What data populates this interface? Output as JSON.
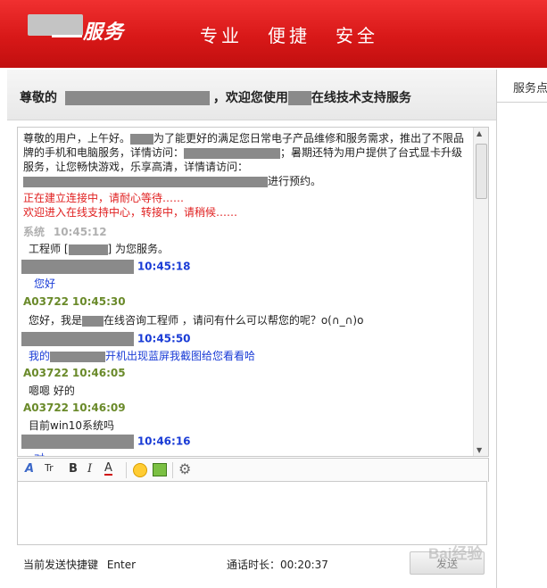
{
  "header": {
    "logo_text": "服务",
    "slogans": [
      "专业",
      "便捷",
      "安全"
    ],
    "brand_color": "#d81818"
  },
  "welcome": {
    "prefix": "尊敬的",
    "middle": "，欢迎您使用",
    "suffix": "在线技术支持服务"
  },
  "right_panel": {
    "tab_label": "服务点"
  },
  "chat": {
    "intro_1": "尊敬的用户，上午好。",
    "intro_2": "为了能更好的满足您日常电子产品维修和服务需求，推出了不限品牌的手机和电脑服务，详情访问：",
    "intro_3": "；暑期还特为用户提供了台式显卡升级服务，让您畅快游戏，乐享高清，详情请访问：",
    "intro_4": "进行预约。",
    "connecting": "正在建立连接中，请耐心等待……",
    "entering": "欢迎进入在线支持中心，转接中，请稍候……",
    "messages": [
      {
        "sender": "系统",
        "time": "10:45:12",
        "text_prefix": "工程师 [",
        "text_suffix": "] 为您服务。"
      },
      {
        "sender": "",
        "time": "10:45:18",
        "text": "您好"
      },
      {
        "sender": "A03722",
        "time": "10:45:30",
        "text_prefix": "您好，我是",
        "text_suffix": "在线咨询工程师 ，请问有什么可以帮您的呢？o(∩_∩)o"
      },
      {
        "sender": "",
        "time": "10:45:50",
        "text_prefix": "我的",
        "text_suffix": "开机出现蓝屏我截图给您看看哈"
      },
      {
        "sender": "A03722",
        "time": "10:46:05",
        "text": "嗯嗯 好的"
      },
      {
        "sender": "A03722",
        "time": "10:46:09",
        "text": "目前win10系统吗"
      },
      {
        "sender": "",
        "time": "10:46:16",
        "text": "对"
      }
    ]
  },
  "toolbar": {
    "font_icon": "A",
    "size_icon": "Tr",
    "bold_icon": "B",
    "italic_icon": "I",
    "color_icon": "A"
  },
  "footer": {
    "shortcut_label": "当前发送快捷键",
    "shortcut_key": "Enter",
    "duration_label": "通话时长：",
    "duration_value": "00:20:37",
    "send_label": "发送"
  },
  "watermark": "Bai经验"
}
